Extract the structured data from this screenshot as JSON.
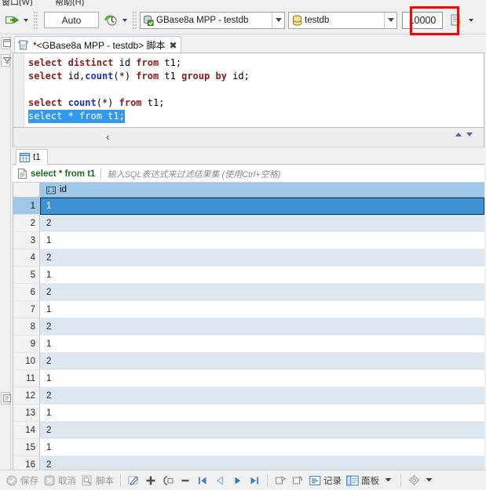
{
  "window": {
    "menu_sliver": [
      "窗口(W)",
      "帮助(H)"
    ]
  },
  "toolbar": {
    "execute_icon": "execute-arrow-icon",
    "execute_dropdown_icon": "chevron-down-icon",
    "auto_commit_label": "Auto",
    "commit_mode_icon": "clock-refresh-icon",
    "commit_dropdown_icon": "chevron-down-icon",
    "connection": {
      "icon": "database-connection-icon",
      "value": "GBase8a MPP - testdb",
      "dropdown_icon": "chevron-down-icon"
    },
    "schema": {
      "icon": "database-schema-icon",
      "value": "testdb",
      "dropdown_icon": "chevron-down-icon"
    },
    "fetch_size": {
      "value": "10000",
      "placeholder": "10000",
      "highlight_color": "#ff0000"
    },
    "transaction_log_icon": "transaction-log-icon",
    "transaction_dropdown_icon": "chevron-down-icon"
  },
  "rail": {
    "top_icon": "restore-view-icon",
    "filter_icon": "filter-icon",
    "bottom_icon": "projects-view-icon"
  },
  "editor_tab": {
    "icon": "sql-script-icon",
    "label": "*<GBase8a MPP - testdb> 脚本",
    "close_icon": "close-icon"
  },
  "editor": {
    "lines": [
      [
        {
          "t": "select",
          "c": "kw"
        },
        {
          "t": " ",
          "c": "pl"
        },
        {
          "t": "distinct",
          "c": "kw"
        },
        {
          "t": " id ",
          "c": "pl"
        },
        {
          "t": "from",
          "c": "kw"
        },
        {
          "t": " t1;",
          "c": "pl"
        }
      ],
      [
        {
          "t": "select",
          "c": "kw"
        },
        {
          "t": " id,",
          "c": "pl"
        },
        {
          "t": "count",
          "c": "fn"
        },
        {
          "t": "(*) ",
          "c": "pl"
        },
        {
          "t": "from",
          "c": "kw"
        },
        {
          "t": " t1 ",
          "c": "pl"
        },
        {
          "t": "group",
          "c": "kw"
        },
        {
          "t": " ",
          "c": "pl"
        },
        {
          "t": "by",
          "c": "kw"
        },
        {
          "t": " id;",
          "c": "pl"
        }
      ],
      [],
      [
        {
          "t": "select",
          "c": "kw"
        },
        {
          "t": " ",
          "c": "pl"
        },
        {
          "t": "count",
          "c": "fn"
        },
        {
          "t": "(*) ",
          "c": "pl"
        },
        {
          "t": "from",
          "c": "kw"
        },
        {
          "t": " t1;",
          "c": "pl"
        }
      ]
    ],
    "selected_line": "select * from t1;",
    "collapse_marker": "‹",
    "nav_prev_icon": "nav-up-icon",
    "nav_next_icon": "nav-down-icon"
  },
  "results": {
    "tab": {
      "icon": "grid-table-icon",
      "label": "t1"
    },
    "filter": {
      "icon": "sql-statement-icon",
      "query": "select * from t1",
      "placeholder": "输入SQL表达式来过滤结果集 (使用Ctrl+空格)"
    },
    "columns": [
      {
        "name": "id",
        "type_icon": "numeric-column-icon"
      }
    ],
    "rows": [
      {
        "n": "1",
        "id": "1"
      },
      {
        "n": "2",
        "id": "2"
      },
      {
        "n": "3",
        "id": "1"
      },
      {
        "n": "4",
        "id": "2"
      },
      {
        "n": "5",
        "id": "1"
      },
      {
        "n": "6",
        "id": "2"
      },
      {
        "n": "7",
        "id": "1"
      },
      {
        "n": "8",
        "id": "2"
      },
      {
        "n": "9",
        "id": "1"
      },
      {
        "n": "10",
        "id": "2"
      },
      {
        "n": "11",
        "id": "1"
      },
      {
        "n": "12",
        "id": "2"
      },
      {
        "n": "13",
        "id": "1"
      },
      {
        "n": "14",
        "id": "2"
      },
      {
        "n": "15",
        "id": "1"
      },
      {
        "n": "16",
        "id": "2"
      }
    ],
    "selected_row_index": 0
  },
  "bottombar": {
    "save_label": "保存",
    "save_icon": "save-check-icon",
    "cancel_label": "取消",
    "cancel_icon": "cancel-x-icon",
    "script_label": "脚本",
    "script_icon": "generate-script-icon",
    "edit_icon": "edit-cell-icon",
    "add_icon": "add-row-icon",
    "duplicate_icon": "duplicate-row-icon",
    "delete_icon": "delete-row-icon",
    "first_icon": "first-page-icon",
    "prev_icon": "prev-page-icon",
    "next_icon": "next-page-icon",
    "last_icon": "last-page-icon",
    "fetch_next_icon": "fetch-next-page-icon",
    "fetch_all_icon": "fetch-all-rows-icon",
    "records_label": "记录",
    "records_icon": "records-view-icon",
    "panels_label": "面板",
    "panels_icon": "panels-view-icon",
    "panels_dropdown_icon": "chevron-down-icon",
    "settings_icon": "gear-icon",
    "settings_dropdown_icon": "chevron-down-icon"
  }
}
